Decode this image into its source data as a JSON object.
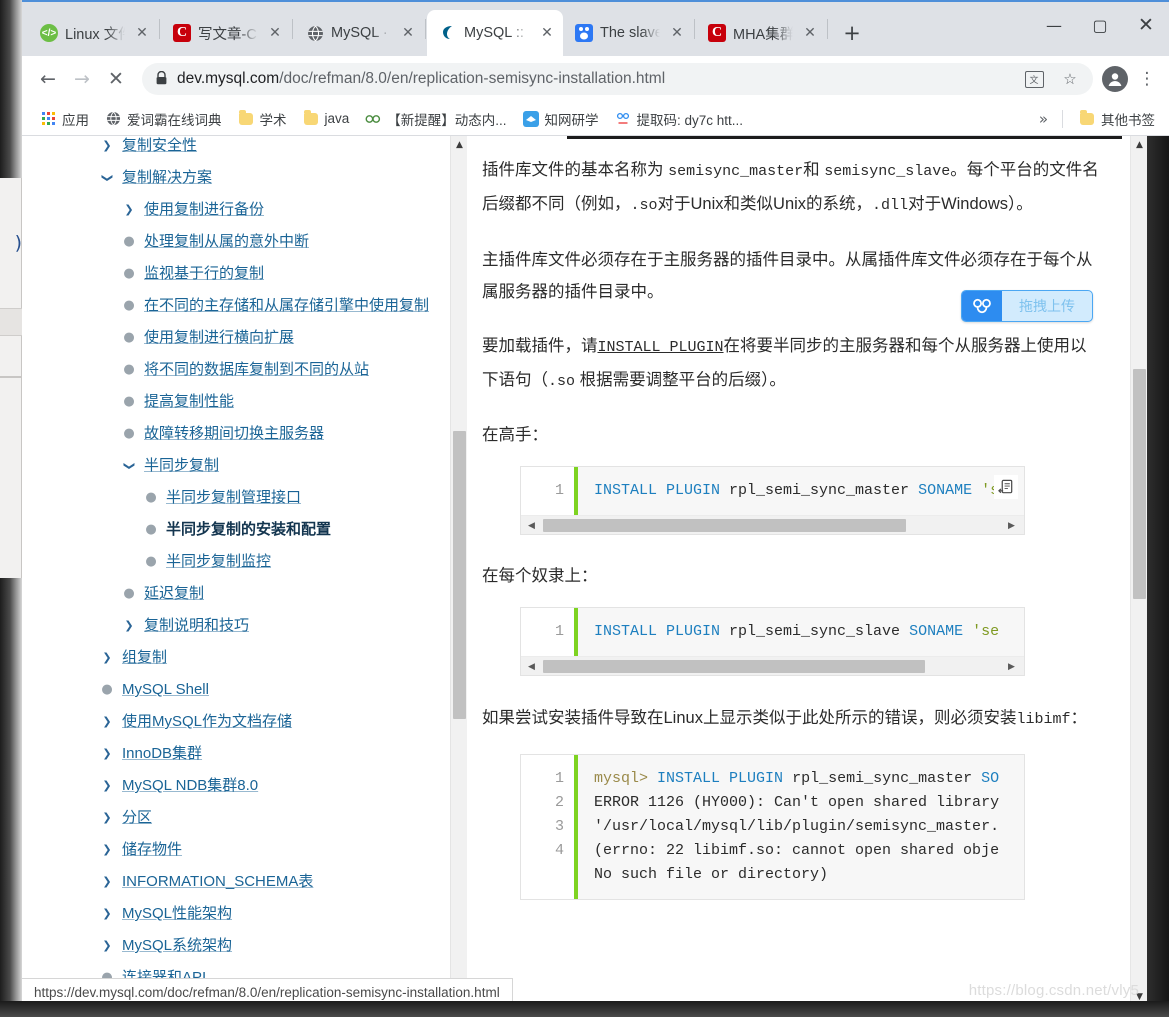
{
  "window": {
    "controls": {
      "minimize": "—",
      "maximize": "▢",
      "close": "✕"
    },
    "newtab_label": "+"
  },
  "tabs": [
    {
      "title": "Linux 文件",
      "favicon": "linux-favicon",
      "glyph": "</>",
      "close": "✕",
      "active": false
    },
    {
      "title": "写文章-CSDN",
      "favicon": "csdn-favicon",
      "glyph": "C",
      "close": "✕",
      "active": false
    },
    {
      "title": "MySQL ·",
      "favicon": "globe-favicon",
      "glyph": "🌐",
      "close": "✕",
      "active": false
    },
    {
      "title": "MySQL ::",
      "favicon": "mysql-favicon",
      "glyph": "🐬",
      "close": "✕",
      "active": true
    },
    {
      "title": "The slave",
      "favicon": "baidu-favicon",
      "glyph": "熊",
      "close": "✕",
      "active": false
    },
    {
      "title": "MHA集群",
      "favicon": "csdn-favicon",
      "glyph": "C",
      "close": "✕",
      "active": false
    }
  ],
  "toolbar": {
    "back": "←",
    "forward": "→",
    "stop": "✕",
    "lock_icon": "🔒",
    "url_host": "dev.mysql.com",
    "url_path": "/doc/refman/8.0/en/replication-semisync-installation.html",
    "translate_label": "文",
    "bookmark_star": "☆",
    "profile_glyph": "●",
    "menu_glyph": "⋮"
  },
  "bookmarks": {
    "items": [
      {
        "label": "应用",
        "icon": "apps-grid-icon"
      },
      {
        "label": "爱词霸在线词典",
        "icon": "globe-icon"
      },
      {
        "label": "学术",
        "icon": "folder-icon"
      },
      {
        "label": "java",
        "icon": "folder-icon"
      },
      {
        "label": "【新提醒】动态内...",
        "icon": "infinity-icon"
      },
      {
        "label": "知网研学",
        "icon": "cnki-icon"
      },
      {
        "label": "提取码: dy7c  htt...",
        "icon": "baidu-pan-icon"
      }
    ],
    "overflow": "»",
    "other": {
      "label": "其他书签",
      "icon": "folder-icon"
    }
  },
  "sidebar": {
    "items": [
      {
        "label": "复制安全性",
        "marker": "arrow-r",
        "depth": 0,
        "current": false
      },
      {
        "label": "复制解决方案",
        "marker": "arrow-d",
        "depth": 0,
        "current": false
      },
      {
        "label": "使用复制进行备份",
        "marker": "arrow-r",
        "depth": 1,
        "current": false
      },
      {
        "label": "处理复制从属的意外中断",
        "marker": "dot",
        "depth": 1,
        "current": false
      },
      {
        "label": "监视基于行的复制",
        "marker": "dot",
        "depth": 1,
        "current": false
      },
      {
        "label": "在不同的主存储和从属存储引擎中使用复制",
        "marker": "dot",
        "depth": 1,
        "current": false
      },
      {
        "label": "使用复制进行横向扩展",
        "marker": "dot",
        "depth": 1,
        "current": false
      },
      {
        "label": "将不同的数据库复制到不同的从站",
        "marker": "dot",
        "depth": 1,
        "current": false
      },
      {
        "label": "提高复制性能",
        "marker": "dot",
        "depth": 1,
        "current": false
      },
      {
        "label": "故障转移期间切换主服务器",
        "marker": "dot",
        "depth": 1,
        "current": false
      },
      {
        "label": "半同步复制",
        "marker": "arrow-d",
        "depth": 1,
        "current": false
      },
      {
        "label": "半同步复制管理接口",
        "marker": "dot",
        "depth": 2,
        "current": false
      },
      {
        "label": "半同步复制的安装和配置",
        "marker": "dot",
        "depth": 2,
        "current": true
      },
      {
        "label": "半同步复制监控",
        "marker": "dot",
        "depth": 2,
        "current": false
      },
      {
        "label": "延迟复制",
        "marker": "dot",
        "depth": 1,
        "current": false
      },
      {
        "label": "复制说明和技巧",
        "marker": "arrow-r",
        "depth": 1,
        "current": false
      },
      {
        "label": "组复制",
        "marker": "arrow-r",
        "depth": 0,
        "current": false
      },
      {
        "label": "MySQL Shell",
        "marker": "dot",
        "depth": 0,
        "current": false
      },
      {
        "label": "使用MySQL作为文档存储",
        "marker": "arrow-r",
        "depth": 0,
        "current": false
      },
      {
        "label": "InnoDB集群",
        "marker": "arrow-r",
        "depth": 0,
        "current": false
      },
      {
        "label": "MySQL NDB集群8.0",
        "marker": "arrow-r",
        "depth": 0,
        "current": false
      },
      {
        "label": "分区",
        "marker": "arrow-r",
        "depth": 0,
        "current": false
      },
      {
        "label": "储存物件",
        "marker": "arrow-r",
        "depth": 0,
        "current": false
      },
      {
        "label": "INFORMATION_SCHEMA表",
        "marker": "arrow-r",
        "depth": 0,
        "current": false
      },
      {
        "label": "MySQL性能架构",
        "marker": "arrow-r",
        "depth": 0,
        "current": false
      },
      {
        "label": "MySQL系统架构",
        "marker": "arrow-r",
        "depth": 0,
        "current": false
      },
      {
        "label": "连接器和API",
        "marker": "dot",
        "depth": 0,
        "current": false
      }
    ],
    "scroll_up_glyph": "▲"
  },
  "content": {
    "para1_a": "插件库文件的基本名称为 ",
    "para1_code1": "semisync_master",
    "para1_b": "和 ",
    "para1_code2": "semisync_slave",
    "para1_c": "。每个平台的文件名后缀都不同（例如，",
    "para1_code3": ".so",
    "para1_d": "对于Unix和类似Unix的系统，",
    "para1_code4": ".dll",
    "para1_e": "对于Windows）。",
    "para2": "主插件库文件必须存在于主服务器的插件目录中。从属插件库文件必须存在于每个从属服务器的插件目录中。",
    "para3_a": "要加载插件，请",
    "para3_link": "INSTALL PLUGIN",
    "para3_b": "在将要半同步的主服务器和每个从服务器上使用以下语句（",
    "para3_code": ".so",
    "para3_c": " 根据需要调整平台的后缀）。",
    "lead_master": "在高手：",
    "lead_slave": "在每个奴隶上：",
    "para4_a": "如果尝试安装插件导致在Linux上显示类似于此处所示的错误，则必须安装",
    "para4_code": "libimf",
    "para4_b": "："
  },
  "code_blocks": [
    {
      "name": "install-master-plugin",
      "lines": [
        "1"
      ],
      "text_html": "INSTALL PLUGIN rpl_semi_sync_master SONAME 's",
      "copy_icon": "copy-icon",
      "scroll_left": "◀",
      "scroll_right": "▶"
    },
    {
      "name": "install-slave-plugin",
      "lines": [
        "1"
      ],
      "text_html": "INSTALL PLUGIN rpl_semi_sync_slave SONAME 'se",
      "scroll_left": "◀",
      "scroll_right": "▶"
    },
    {
      "name": "libimf-error-output",
      "lines": [
        "1",
        "2",
        "3",
        "4"
      ],
      "text_html": "mysql> INSTALL PLUGIN rpl_semi_sync_master SO\nERROR 1126 (HY000): Can't open shared library\n'/usr/local/mysql/lib/plugin/semisync_master.\n(errno: 22 libimf.so: cannot open shared obje\nNo such file or directory)"
    }
  ],
  "upload_widget": {
    "label": "拖拽上传",
    "logo_glyph": "☁",
    "border_color": "#4ba7f3",
    "fill_color": "#d2ebfd",
    "logo_color": "#2d8cf0"
  },
  "status": {
    "text": "https://dev.mysql.com/doc/refman/8.0/en/replication-semisync-installation.html"
  },
  "watermark": {
    "text": "https://blog.csdn.net/vly5"
  },
  "scrollbars": {
    "up_glyph": "▲",
    "down_glyph": "▼"
  }
}
